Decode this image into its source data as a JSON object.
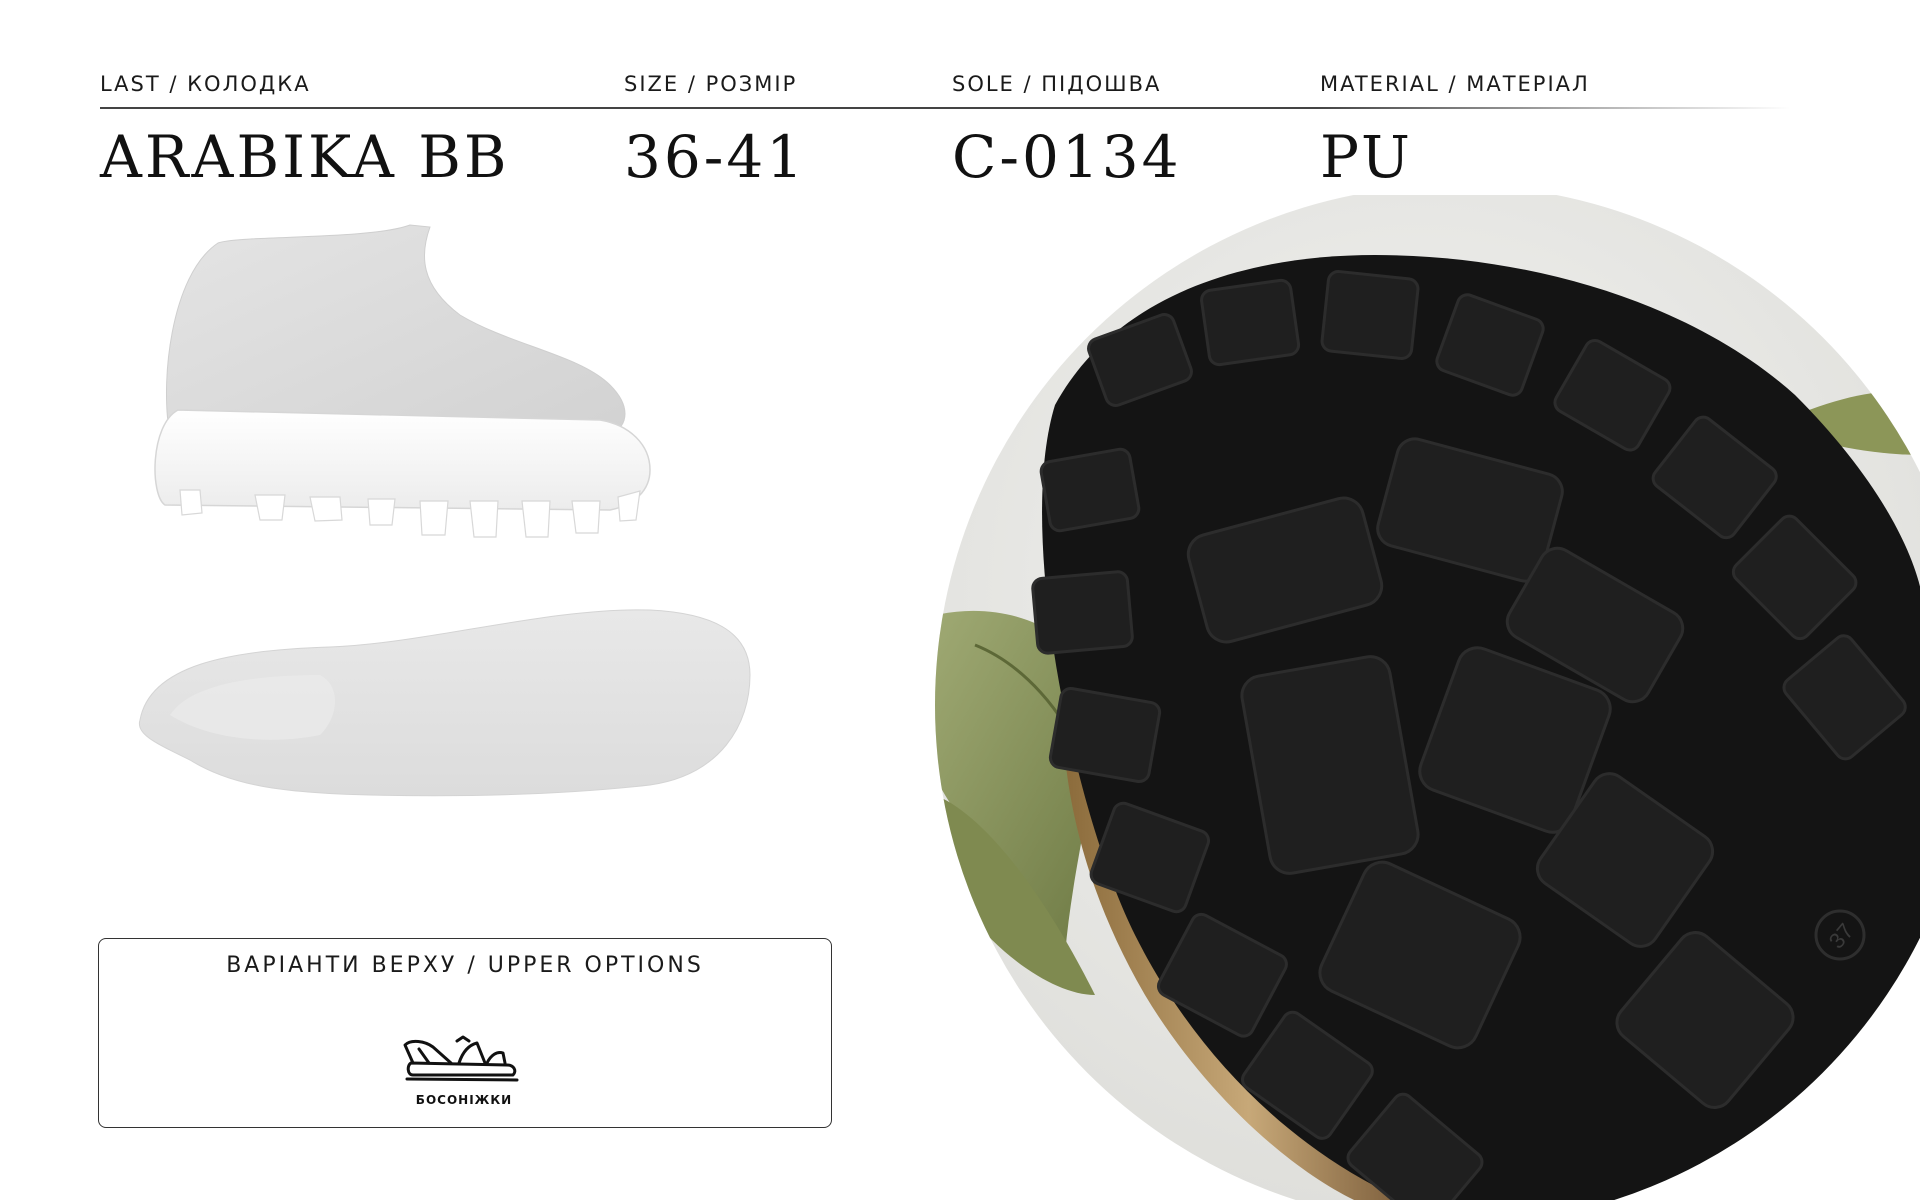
{
  "specs": {
    "last": {
      "label": "LAST / КОЛОДКА",
      "value": "ARABIKA BB"
    },
    "size": {
      "label": "SIZE / РОЗМІР",
      "value": "36-41"
    },
    "sole": {
      "label": "SOLE / ПІДОШВА",
      "value": "C-0134"
    },
    "material": {
      "label": "MATERIAL / МАТЕРІАЛ",
      "value": "PU"
    }
  },
  "upper_options": {
    "title": "ВАРІАНТИ ВЕРХУ / UPPER OPTIONS",
    "items": [
      {
        "label": "БОСОНІЖКИ",
        "icon": "sandal-icon"
      }
    ]
  },
  "sole_photo": {
    "size_mark": "37"
  },
  "colors": {
    "sole_black": "#141414",
    "leaf_green": "#8d9a62",
    "last_grey": "#d9d9d9"
  }
}
